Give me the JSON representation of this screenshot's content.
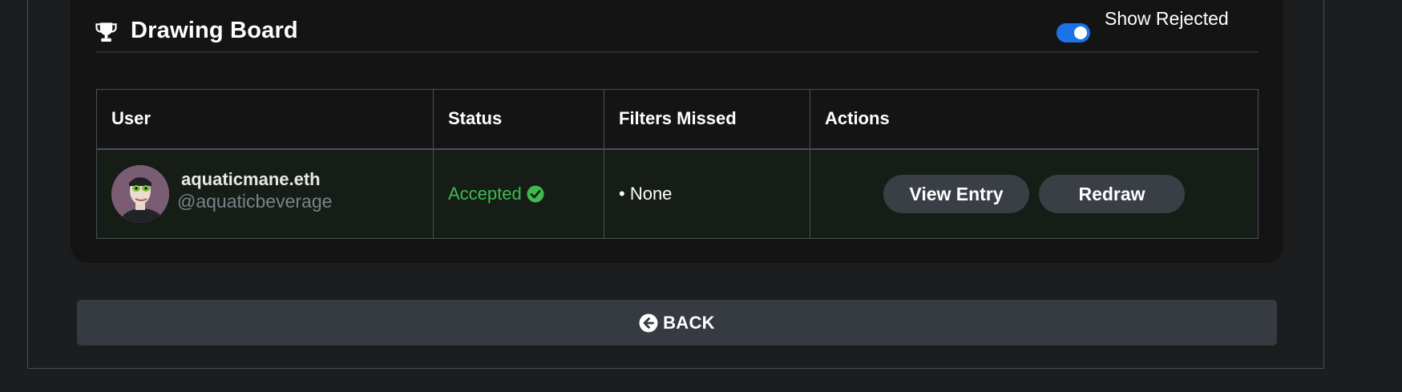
{
  "card": {
    "title": "Drawing Board",
    "title_icon": "trophy-icon",
    "show_rejected": {
      "label": "Show Rejected",
      "enabled": true,
      "color": "#1a73e8"
    }
  },
  "table": {
    "headers": [
      "User",
      "Status",
      "Filters Missed",
      "Actions"
    ],
    "rows": [
      {
        "user_name": "aquaticmane.eth",
        "user_handle": "@aquaticbeverage",
        "status": "Accepted",
        "status_color": "#3fb950",
        "status_icon": "check-circle-icon",
        "filters_missed": "• None",
        "actions": [
          "View Entry",
          "Redraw"
        ]
      }
    ]
  },
  "back_button": {
    "label": "BACK",
    "icon": "arrow-left-circle-icon"
  }
}
